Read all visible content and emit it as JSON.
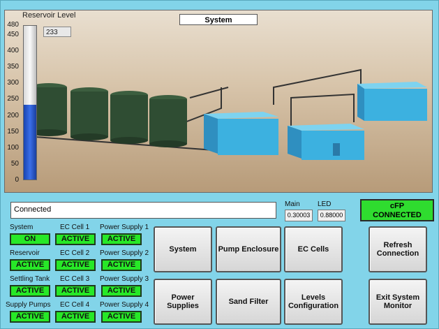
{
  "scene": {
    "title": "System",
    "reservoir_label": "Reservoir Level",
    "reservoir_value": "233",
    "reservoir_level": 233,
    "reservoir_max": 480,
    "ticks": [
      "480",
      "450",
      "400",
      "350",
      "300",
      "250",
      "200",
      "150",
      "100",
      "50",
      "0"
    ]
  },
  "status": {
    "message": "Connected"
  },
  "readouts": {
    "main_label": "Main",
    "main_value": "0.30003",
    "led_label": "LED",
    "led_value": "0.88000"
  },
  "cfp": {
    "line1": "cFP",
    "line2": "CONNECTED"
  },
  "indicators": {
    "system": {
      "label": "System",
      "value": "ON"
    },
    "reservoir": {
      "label": "Reservoir",
      "value": "ACTIVE"
    },
    "settling_tank": {
      "label": "Settling Tank",
      "value": "ACTIVE"
    },
    "supply_pumps": {
      "label": "Supply Pumps",
      "value": "ACTIVE"
    },
    "ec_cell_1": {
      "label": "EC Cell 1",
      "value": "ACTIVE"
    },
    "ec_cell_2": {
      "label": "EC Cell 2",
      "value": "ACTIVE"
    },
    "ec_cell_3": {
      "label": "EC Cell 3",
      "value": "ACTIVE"
    },
    "ec_cell_4": {
      "label": "EC Cell 4",
      "value": "ACTIVE"
    },
    "power_supply_1": {
      "label": "Power Supply 1",
      "value": "ACTIVE"
    },
    "power_supply_2": {
      "label": "Power Supply 2",
      "value": "ACTIVE"
    },
    "power_supply_3": {
      "label": "Power Supply 3",
      "value": "ACTIVE"
    },
    "power_supply_4": {
      "label": "Power Supply 4",
      "value": "ACTIVE"
    }
  },
  "buttons": {
    "system": "System",
    "pump_enclosure": "Pump Enclosure",
    "ec_cells": "EC Cells",
    "refresh_connection": "Refresh Connection",
    "power_supplies": "Power Supplies",
    "sand_filter": "Sand Filter",
    "levels_configuration": "Levels Configuration",
    "exit_system_monitor": "Exit System Monitor"
  },
  "colors": {
    "panel": "#82d4e9",
    "active_green": "#27e827",
    "tank_blue": "#2a5ed8",
    "equipment_blue": "#3cb1e0",
    "tank_green": "#2f4d33"
  }
}
